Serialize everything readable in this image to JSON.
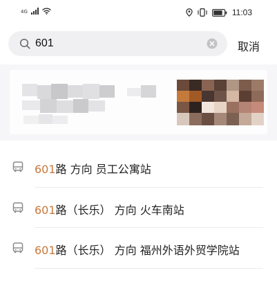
{
  "status_bar": {
    "network": "4G",
    "time": "11:03"
  },
  "search": {
    "query": "601",
    "cancel_label": "取消"
  },
  "results": [
    {
      "route": "601",
      "name": "路 方向 员工公寓站"
    },
    {
      "route": "601",
      "name": "路（长乐） 方向 火车南站"
    },
    {
      "route": "601",
      "name": "路（长乐） 方向 福州外语外贸学院站"
    }
  ],
  "colors": {
    "highlight": "#c8783a",
    "search_bg": "#f0f0f3",
    "icon_gray": "#8a8a8a"
  },
  "icons": [
    "signal-icon",
    "wifi-icon",
    "location-icon",
    "vibrate-icon",
    "battery-icon",
    "search-icon",
    "clear-icon",
    "bus-icon"
  ]
}
